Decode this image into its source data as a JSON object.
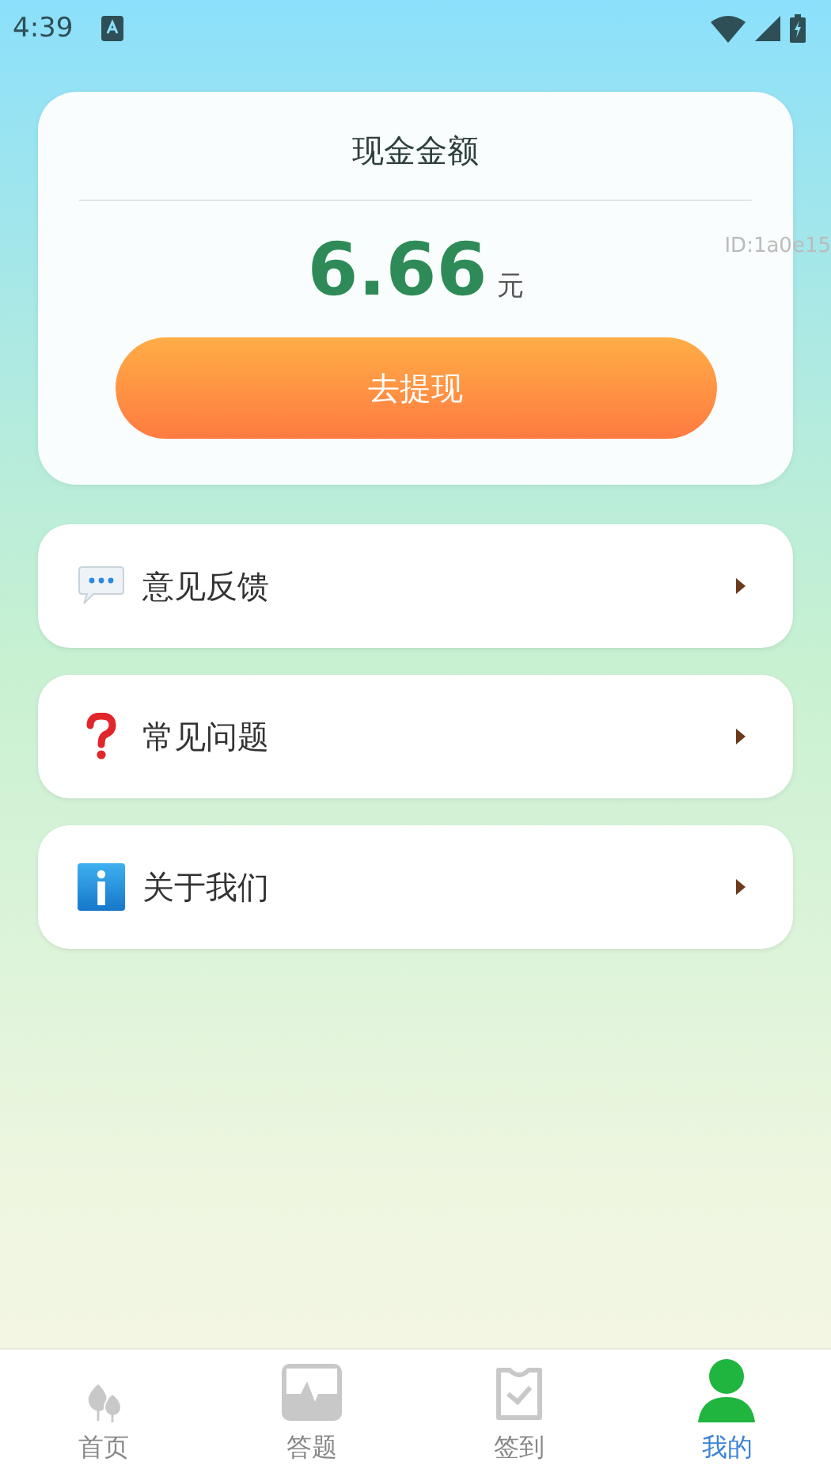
{
  "status_bar": {
    "time": "4:39"
  },
  "cash_card": {
    "title": "现金金额",
    "amount": "6.66",
    "unit": "元",
    "user_id": "ID:1a0e15",
    "button": "去提现"
  },
  "menu": [
    {
      "label": "意见反馈"
    },
    {
      "label": "常见问题"
    },
    {
      "label": "关于我们"
    }
  ],
  "bottom_nav": [
    {
      "label": "首页",
      "selected": false
    },
    {
      "label": "答题",
      "selected": false
    },
    {
      "label": "签到",
      "selected": false
    },
    {
      "label": "我的",
      "selected": true
    }
  ]
}
